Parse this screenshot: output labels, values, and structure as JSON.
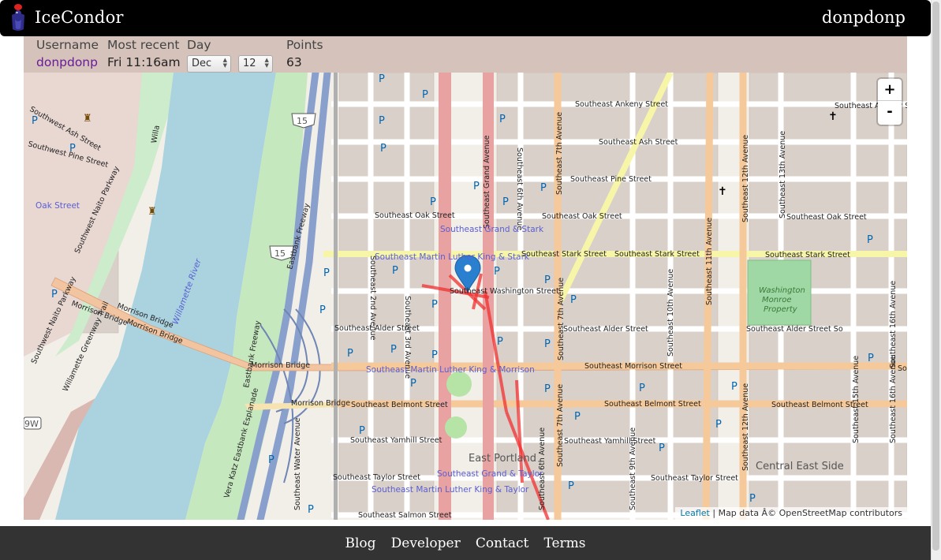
{
  "header": {
    "brand": "IceCondor",
    "user": "donpdonp"
  },
  "info": {
    "username_label": "Username",
    "username": "donpdonp",
    "recent_label": "Most recent",
    "recent": "Fri 11:16am",
    "day_label": "Day",
    "day_month": "Dec",
    "day_date": "12",
    "points_label": "Points",
    "points": "63"
  },
  "map": {
    "zoom_in": "+",
    "zoom_out": "-",
    "attrib_leaflet": "Leaflet",
    "attrib_text": " | Map data Â© OpenStreetMap contributors",
    "shields": {
      "i5_a": "15",
      "i5_b": "15",
      "w99": "9W"
    },
    "labels": {
      "se_ankeny": "Southeast Ankeny Street",
      "se_ankeny_right": "Southeast Ankeny St",
      "se_ash": "Southeast Ash Street",
      "se_pine": "Southeast Pine Street",
      "se_oak_left": "Southeast Oak Street",
      "se_oak_mid": "Southeast Oak Street",
      "se_oak_right": "Southeast Oak Street",
      "se_stark_mid": "Southeast Stark Street",
      "se_stark_r1": "Southeast Stark Street",
      "se_stark_r2": "Southeast Stark Street",
      "se_washington": "Southeast Washington Street",
      "se_alder_left": "Southeast Alder Street",
      "se_alder_mid": "Southeast Alder Street",
      "se_alder_right": "Southeast Alder Street  So",
      "se_morrison_mid": "Southeast Morrison Street",
      "se_morrison_right": "So",
      "se_belmont_left": "Southeast Belmont Street",
      "se_belmont_mid": "Southeast Belmont Street",
      "se_belmont_right": "Southeast Belmont Street",
      "se_yamhill_left": "Southeast Yamhill Street",
      "se_yamhill_mid": "Southeast Yamhill Street",
      "se_taylor_left": "Southeast Taylor Street",
      "se_taylor_mid": "Southeast Taylor Street",
      "se_salmon": "Southeast Salmon Street",
      "sw_ash": "Southwest Ash Street",
      "sw_pine": "Southwest Pine Street",
      "oak_street": "Oak Street",
      "sw_naito_a": "Southwest Naito Parkway",
      "sw_naito_b": "Southwest Naito Parkway",
      "morrison_bridge_a": "Morrison Bridge",
      "morrison_bridge_b": "Morrison Bridge",
      "morrison_bridge_c": "Morrison Bridge",
      "morrison_bridge_d": "Morrison Bridge",
      "morrison_bridge_e": "Morrison Bridge",
      "willamette": "Willamette River",
      "eastbank_a": "Eastbank Freeway",
      "eastbank_b": "Eastbank Freeway",
      "willamette_greenway": "Willamette Greenway Trail",
      "vera_katz": "Vera Katz Eastbank Esplanade",
      "se_water": "Southeast Water Avenue",
      "se_2nd": "Southeast 2nd Avenue",
      "se_3rd": "Southeast 3rd Avenue",
      "se_grand": "Southeast Grand Avenue",
      "se_6th_a": "Southeast 6th Avenue",
      "se_6th_b": "Southeast 6th Avenue",
      "se_7th_a": "Southeast 7th Avenue",
      "se_7th_b": "Southeast 7th Avenue",
      "se_7th_c": "Southeast 7th Avenue",
      "se_9th": "Southeast 9th Avenue",
      "se_10th": "Southeast 10th Avenue",
      "se_11th": "Southeast 11th Avenue",
      "se_12th_a": "Southeast 12th Avenue",
      "se_12th_b": "Southeast 12th Avenue",
      "se_12th_c": "Southeast 12th Avenue",
      "se_13th": "Southeast 13th Avenue",
      "se_15th": "Southeast 15th Avenue",
      "se_16th_a": "Southeast 16th Avenue",
      "se_16th_b": "Southeast 16th Avenue",
      "willa": "Willa",
      "grand_stark": "Southeast Grand & Stark",
      "mlk_stark": "Southeast Martin Luther King & Stark",
      "mlk_morrison": "Southeast Martin Luther King & Morrison",
      "grand_taylor": "Southeast Grand & Taylor",
      "mlk_taylor": "Southeast Martin Luther King & Taylor",
      "east_portland": "East Portland",
      "central_east_side": "Central East Side",
      "washington_monroe": "Washington Monroe Property",
      "wm_line1": "Washington",
      "wm_line2": "Monroe",
      "wm_line3": "Property",
      "parking": "P"
    }
  },
  "footer": {
    "links": [
      "Blog",
      "Developer",
      "Contact",
      "Terms"
    ]
  },
  "colors": {
    "header_bg": "#000000",
    "infobar_bg": "#d5c2bb",
    "footer_bg": "#333333",
    "track_red": "#f03030",
    "marker_blue": "#2a7fcf",
    "username_purple": "#6a1b9a"
  }
}
